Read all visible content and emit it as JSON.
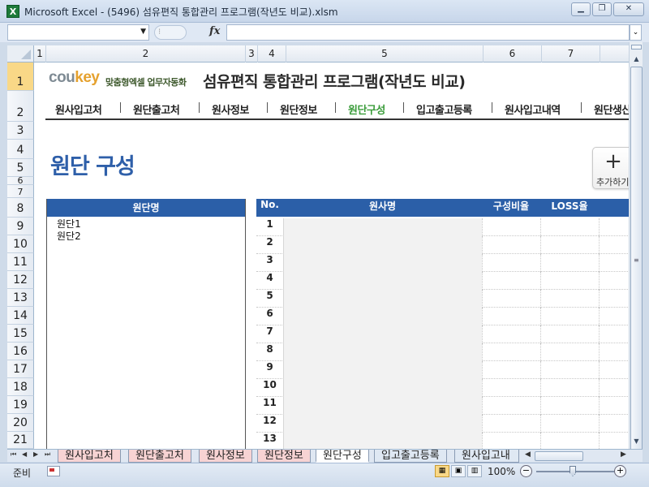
{
  "window": {
    "title": "Microsoft Excel - (5496) 섬유편직 통합관리 프로그램(작년도 비교).xlsm",
    "app_icon": "X",
    "buttons": [
      "minimize-icon",
      "restore-icon",
      "close-icon"
    ]
  },
  "formula_bar": {
    "name_box": "",
    "fx_label": "fx",
    "value": ""
  },
  "columns": [
    "1",
    "2",
    "3",
    "4",
    "5",
    "6",
    "7"
  ],
  "rows": [
    "1",
    "2",
    "3",
    "4",
    "5",
    "6",
    "7",
    "8",
    "9",
    "10",
    "11",
    "12",
    "13",
    "14",
    "15",
    "16",
    "17",
    "18",
    "19",
    "20",
    "21"
  ],
  "brand": {
    "logo_main": "cou",
    "logo_accent": "key",
    "tagline": "맞춤형엑셀 업무자동화",
    "accent_color": "#e5a12e"
  },
  "app_title": "섬유편직 통합관리 프로그램(작년도 비교)",
  "nav": {
    "items": [
      "원사입고처",
      "원단출고처",
      "원사정보",
      "원단정보",
      "원단구성",
      "입고출고등록",
      "원사입고내역",
      "원단생산"
    ],
    "active_index": 4,
    "active_color": "#3a9c3a"
  },
  "section_title": "원단 구성",
  "add_button": {
    "icon": "plus-icon",
    "label": "추가하기"
  },
  "fabric_list": {
    "header": "원단명",
    "items": [
      "원단1",
      "원단2"
    ]
  },
  "composition_table": {
    "headers": {
      "no": "No.",
      "yarn_name": "원사명",
      "ratio": "구성비율",
      "loss": "LOSS율"
    },
    "row_numbers": [
      "1",
      "2",
      "3",
      "4",
      "5",
      "6",
      "7",
      "8",
      "9",
      "10",
      "11",
      "12",
      "13"
    ],
    "header_color": "#2b5fa8"
  },
  "sheet_tabs": {
    "items": [
      "원사입고처",
      "원단출고처",
      "원사정보",
      "원단정보",
      "원단구성",
      "입고출고등록",
      "원사입고내"
    ],
    "active_index": 4
  },
  "status_bar": {
    "status": "준비",
    "zoom": "100%",
    "zoom_minus": "−",
    "zoom_plus": "+"
  }
}
